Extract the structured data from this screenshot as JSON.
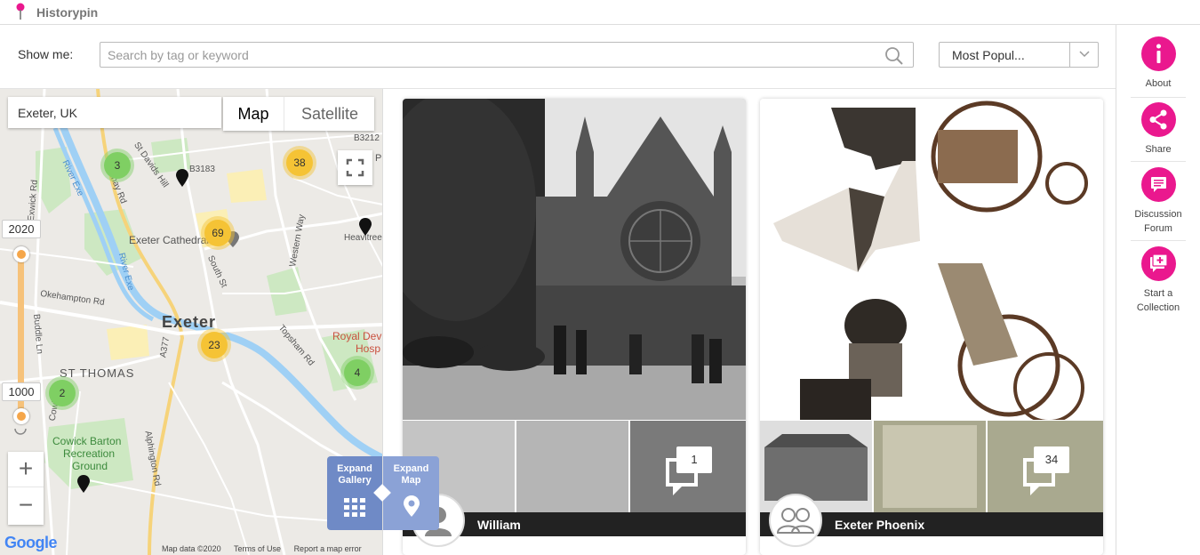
{
  "app": {
    "title": "Historypin"
  },
  "search": {
    "label": "Show me:",
    "placeholder": "Search by tag or keyword",
    "value": ""
  },
  "sort": {
    "selected": "Most Popul..."
  },
  "map": {
    "location": "Exeter, UK",
    "type_map": "Map",
    "type_satellite": "Satellite",
    "timeline": {
      "from": "1000",
      "to": "2020"
    },
    "zoom_in": "+",
    "zoom_out": "−",
    "clusters": [
      "3",
      "38",
      "69",
      "23",
      "2",
      "4"
    ],
    "labels": {
      "exeter": "Exeter",
      "st_thomas": "ST THOMAS",
      "cathedral": "Exeter Cathedral",
      "royal_devon": "Royal Dev",
      "royal_devon2": "Hosp",
      "cowick_1": "Cowick Barton",
      "cowick_2": "Recreation",
      "cowick_3": "Ground",
      "river_exe": "River Exe",
      "river_exe2": "River Exe",
      "bonhay": "Bonhay Rd",
      "st_davids": "St Davids Hill",
      "okehampton": "Okehampton Rd",
      "south_st": "South St",
      "western_way": "Western Way",
      "topsham": "Topsham Rd",
      "a377": "A377",
      "alphington": "Alphington Rd",
      "buddle": "Buddle Ln",
      "cowick_ln": "Cowick Ln",
      "exwick": "Exwick Rd",
      "b3212": "B3212",
      "b3183": "B3183",
      "heavitree": "Heavitree",
      "p": "P"
    },
    "footer": {
      "data": "Map data ©2020",
      "terms": "Terms of Use",
      "report": "Report a map error"
    },
    "google": "Google"
  },
  "expand": {
    "gallery": "Expand\nGallery",
    "map": "Expand\nMap"
  },
  "cards": [
    {
      "author": "William",
      "comments": "1"
    },
    {
      "author": "Exeter Phoenix",
      "comments": "34"
    }
  ],
  "sidebar": [
    {
      "label": "About",
      "icon": "info-icon"
    },
    {
      "label": "Share",
      "icon": "share-icon"
    },
    {
      "label": "Discussion Forum",
      "icon": "discussion-icon"
    },
    {
      "label": "Start a Collection",
      "icon": "add-collection-icon"
    }
  ],
  "colors": {
    "accent": "#ea188e",
    "cluster_green": "#7fcf63",
    "cluster_yellow": "#f5c335",
    "expand_blue": "#6f8ac6"
  }
}
